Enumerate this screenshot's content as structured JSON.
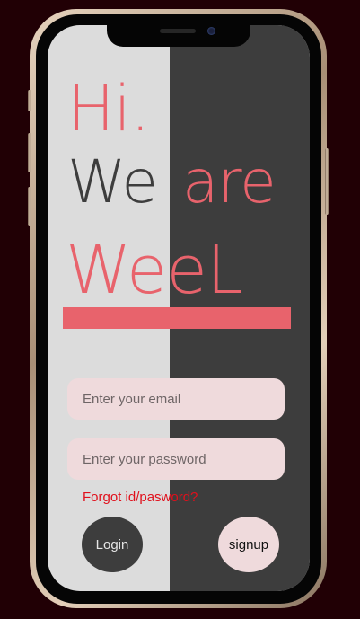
{
  "headline": {
    "line1": "Hi.",
    "line2_part1": "We",
    "line2_part2": "are",
    "line3": "WeeL"
  },
  "form": {
    "email_placeholder": "Enter your email",
    "email_value": "",
    "password_placeholder": "Enter your password",
    "password_value": "",
    "forgot_label": "Forgot id/pasword?",
    "login_label": "Login",
    "signup_label": "signup"
  },
  "colors": {
    "accent": "#e8636c",
    "dark_panel": "#3d3d3d",
    "light_panel": "#dcdcdc",
    "input_bg": "#efdadc",
    "link": "#e0101c",
    "background": "#210005"
  },
  "icons": {
    "camera": "front-camera-icon",
    "speaker": "earpiece-speaker-icon"
  }
}
